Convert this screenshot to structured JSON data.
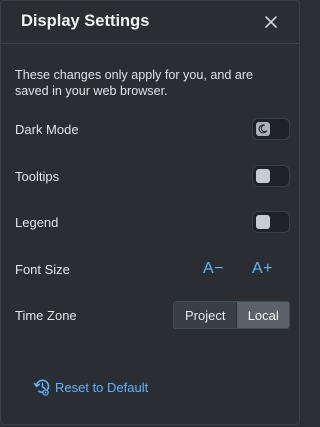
{
  "header": {
    "title": "Display Settings",
    "close_icon": "close-icon"
  },
  "intro": "These changes only apply for you, and are saved in your web browser.",
  "settings": {
    "dark_mode": {
      "label": "Dark Mode",
      "enabled": true,
      "icon": "moon-icon"
    },
    "tooltips": {
      "label": "Tooltips",
      "enabled": false
    },
    "legend": {
      "label": "Legend",
      "enabled": false
    },
    "font_size": {
      "label": "Font Size",
      "decrease": "A−",
      "increase": "A+"
    },
    "time_zone": {
      "label": "Time Zone",
      "options": [
        "Project",
        "Local"
      ],
      "selected": "Local"
    }
  },
  "reset": {
    "label": "Reset to Default",
    "icon": "reset-settings-icon"
  },
  "colors": {
    "accent": "#5cb4ff",
    "background": "#2a2e32",
    "segment_selected": "#5a6169"
  }
}
